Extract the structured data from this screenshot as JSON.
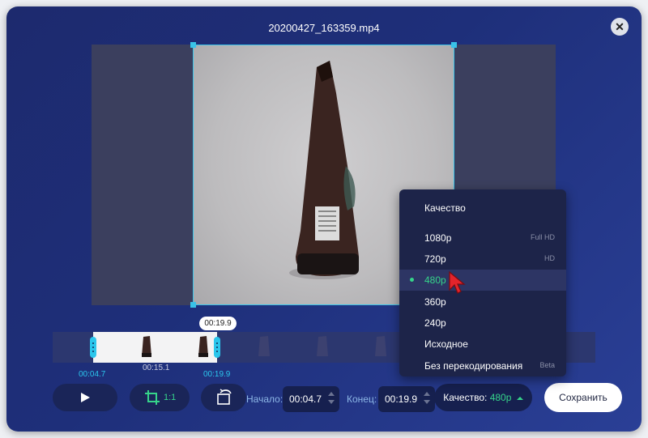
{
  "window": {
    "title": "20200427_163359.mp4"
  },
  "timeline": {
    "bubble_time": "00:19.9",
    "start_time": "00:04.7",
    "mid_time": "00:15.1",
    "end_time": "00:19.9"
  },
  "controls": {
    "crop_ratio": "1:1",
    "start_label": "Начало:",
    "start_value": "00:04.7",
    "end_label": "Конец:",
    "end_value": "00:19.9",
    "quality_label": "Качество:",
    "quality_value": "480p",
    "save_label": "Сохранить"
  },
  "quality_menu": {
    "title": "Качество",
    "items": [
      {
        "label": "1080p",
        "tag": "Full HD"
      },
      {
        "label": "720p",
        "tag": "HD"
      },
      {
        "label": "480p",
        "tag": ""
      },
      {
        "label": "360p",
        "tag": ""
      },
      {
        "label": "240p",
        "tag": ""
      },
      {
        "label": "Исходное",
        "tag": ""
      },
      {
        "label": "Без перекодирования",
        "tag": "Beta"
      }
    ]
  },
  "colors": {
    "accent": "#2bc6ec",
    "selected": "#36d48a",
    "background": "#1e2f7a"
  }
}
